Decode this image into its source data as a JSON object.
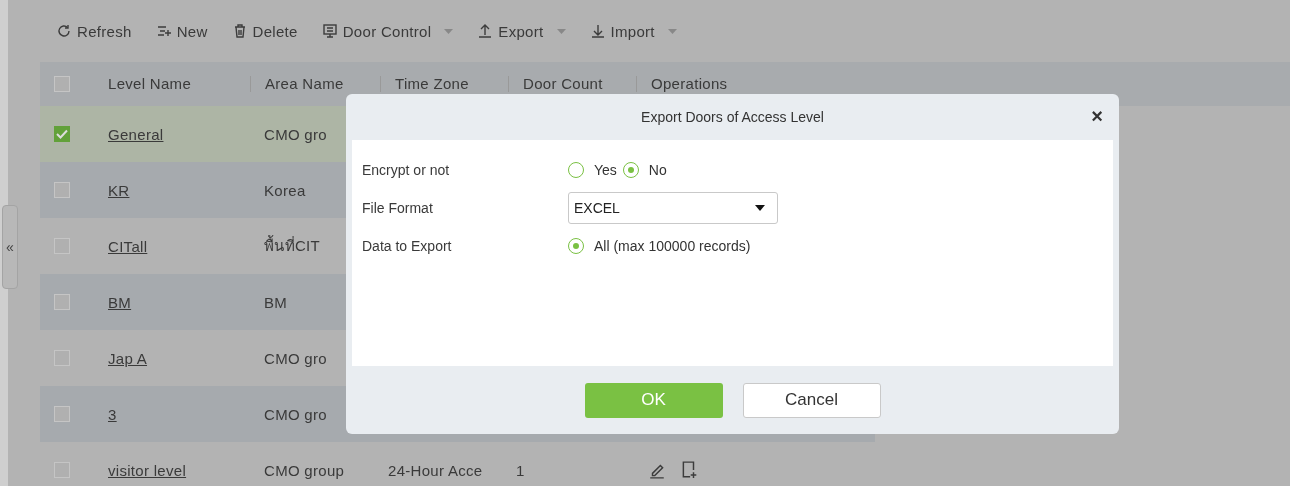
{
  "sidebar_toggle": {
    "label": "«"
  },
  "toolbar": [
    {
      "label": "Refresh",
      "dropdown": false
    },
    {
      "label": "New",
      "dropdown": false
    },
    {
      "label": "Delete",
      "dropdown": false
    },
    {
      "label": "Door Control",
      "dropdown": true
    },
    {
      "label": "Export",
      "dropdown": true
    },
    {
      "label": "Import",
      "dropdown": true
    }
  ],
  "table": {
    "select_all": {
      "checked": false
    },
    "columns": [
      "Level Name",
      "Area Name",
      "Time Zone",
      "Door Count",
      "Operations"
    ],
    "rows": [
      {
        "selected": true,
        "level_name": "General",
        "area_name": "CMO gro"
      },
      {
        "selected": false,
        "level_name": "KR",
        "area_name": "Korea"
      },
      {
        "selected": false,
        "level_name": "CITall",
        "area_name": "พื้นที่CIT"
      },
      {
        "selected": false,
        "level_name": "BM",
        "area_name": "BM"
      },
      {
        "selected": false,
        "level_name": "Jap A",
        "area_name": "CMO gro"
      },
      {
        "selected": false,
        "level_name": "3",
        "area_name": "CMO gro"
      },
      {
        "selected": false,
        "level_name": "visitor level",
        "area_name": "CMO group",
        "time_zone": "24-Hour Acce",
        "door_count": "1",
        "actions_shown": true
      }
    ]
  },
  "dialog": {
    "title": "Export Doors of Access Level",
    "close": "×",
    "fields": [
      {
        "kind": "radio",
        "label": "Encrypt or not",
        "options": [
          {
            "label": "Yes",
            "selected": false
          },
          {
            "label": "No",
            "selected": true
          }
        ]
      },
      {
        "kind": "select",
        "label": "File Format",
        "value": "EXCEL"
      },
      {
        "kind": "radio",
        "label": "Data to Export",
        "options": [
          {
            "label": "All (max 100000 records)",
            "selected": true
          }
        ]
      }
    ],
    "buttons": [
      {
        "label": "OK",
        "kind": "primary"
      },
      {
        "label": "Cancel",
        "kind": "default"
      }
    ]
  }
}
